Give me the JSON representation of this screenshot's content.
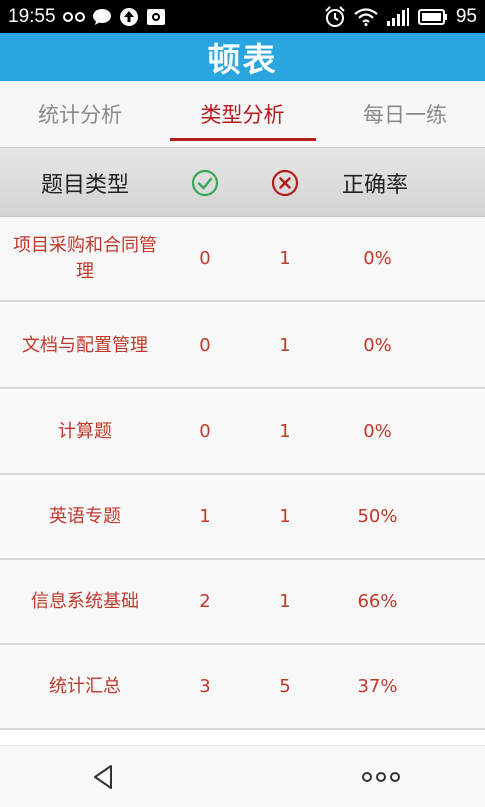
{
  "status_bar": {
    "time": "19:55",
    "battery": "95",
    "icons": [
      "infinity-icon",
      "chat-bubble-icon",
      "upload-icon",
      "photo-icon",
      "alarm-icon",
      "wifi-icon",
      "signal-icon",
      "battery-icon"
    ]
  },
  "header": {
    "title": "顿表"
  },
  "tabs": [
    {
      "label": "统计分析",
      "active": false
    },
    {
      "label": "类型分析",
      "active": true
    },
    {
      "label": "每日一练",
      "active": false
    }
  ],
  "table": {
    "headers": {
      "type": "题目类型",
      "rate": "正确率"
    },
    "header_icons": {
      "correct": "check-circle-icon",
      "wrong": "x-circle-icon"
    },
    "rows": [
      {
        "name": "项目采购和合同管理",
        "correct": "0",
        "wrong": "1",
        "rate": "0%"
      },
      {
        "name": "文档与配置管理",
        "correct": "0",
        "wrong": "1",
        "rate": "0%"
      },
      {
        "name": "计算题",
        "correct": "0",
        "wrong": "1",
        "rate": "0%"
      },
      {
        "name": "英语专题",
        "correct": "1",
        "wrong": "1",
        "rate": "50%"
      },
      {
        "name": "信息系统基础",
        "correct": "2",
        "wrong": "1",
        "rate": "66%"
      },
      {
        "name": "统计汇总",
        "correct": "3",
        "wrong": "5",
        "rate": "37%"
      }
    ]
  },
  "colors": {
    "accent_blue": "#29a6df",
    "accent_red": "#b71c1c",
    "value_red": "#c0392b",
    "correct_green": "#3aa757"
  }
}
